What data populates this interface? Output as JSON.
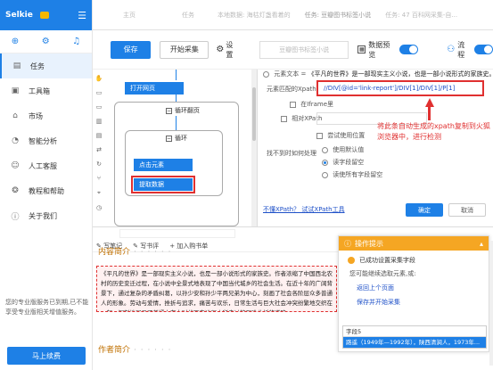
{
  "sidebar": {
    "logo": "Selkie",
    "items": [
      {
        "label": "任务",
        "icon": "list-icon"
      },
      {
        "label": "工具箱",
        "icon": "toolbox-icon"
      },
      {
        "label": "市场",
        "icon": "market-icon"
      },
      {
        "label": "智能分析",
        "icon": "analysis-icon"
      },
      {
        "label": "人工客服",
        "icon": "support-icon"
      },
      {
        "label": "教程和帮助",
        "icon": "help-icon"
      },
      {
        "label": "关于我们",
        "icon": "info-icon"
      }
    ],
    "note": "您的专业版服务已到期,已不能享受专业版相关增值服务。",
    "upgrade_label": "马上续费"
  },
  "tabs": [
    {
      "label": "主页"
    },
    {
      "label": "任务"
    },
    {
      "label": "本地数据: 海枯灯盏看着的"
    },
    {
      "label": "任务: 豆瓣图书标签小说"
    },
    {
      "label": "任务: 47 百科网采集-自..."
    }
  ],
  "toolbar": {
    "save": "保存",
    "start": "开始采集",
    "settings": "设置",
    "task_name": "豆瓣图书标签小说",
    "data_preview": "数据预览",
    "flow": "流程"
  },
  "flow": {
    "nodes": [
      "打开网页",
      "循环翻页",
      "循环",
      "点击元素",
      "提取数据"
    ]
  },
  "right_panel": {
    "element_text_label": "元素文本 =",
    "element_text_value": "《平凡的世界》是一部现实主义小说，也是一部小说形式的家族史。",
    "xpath_label": "元素匹配的Xpath",
    "xpath_value": "//DIV[@id='link-report']/DIV[1]/DIV[1]/P[1]",
    "iframe_label": "在Iframe里",
    "relative_xpath_label": "相对XPath",
    "use_default_label": "尝试使用位置",
    "not_found_label": "找不到时如何处理",
    "opt_default": "使用默认值",
    "opt_empty": "读字段留空",
    "opt_all_empty": "读使所有字段留空",
    "annotation": "将此条自动生成的xpath复制到火狐浏览器中，进行检测",
    "link": "不懂XPath？ 试试XPath工具",
    "ok": "确定",
    "cancel": "取消"
  },
  "browser": {
    "tools": [
      "写笔记",
      "写书评",
      "加入购书单"
    ],
    "section1": "内容简介",
    "content": "《平凡的世界》是一部现实主义小说，也是一部小说形式的家族史。作者浓缩了中国西北农村的历史变迁过程，在小说中全景式地表现了中国当代城乡的社会生活。在近十年的广阔背景下，通过复杂的矛盾纠葛，以孙少安和孙少平两兄弟为中心，刻画了社会各阶层众多普通人的形象。劳动与爱情，挫折与追求，痛苦与欢乐，日常生活与巨大社会冲突纷繁地交织在一起，深刻地展示了普通人在大时代历史进程中所走过的艰难曲折的道路。",
    "section2": "作者简介"
  },
  "tips": {
    "title": "操作提示",
    "success": "已成功设置采集字段",
    "sub": "您可能继续选取元素,或:",
    "link1": "返回上个页面",
    "link2": "保存并开始采集",
    "field_header": "字段5",
    "field_value": "路遥（1949年—1992年），陕西清涧人，1973年..."
  }
}
